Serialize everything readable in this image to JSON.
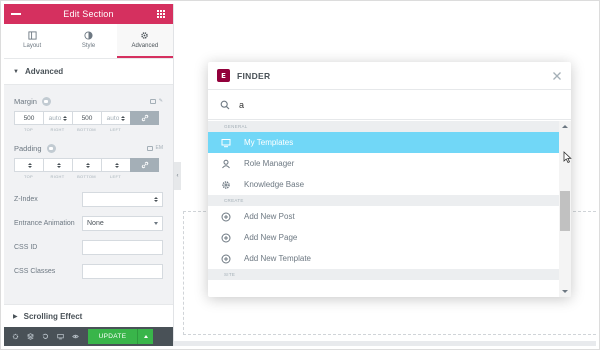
{
  "panel": {
    "title": "Edit Section",
    "tabs": [
      {
        "label": "Layout",
        "icon": "layout-icon"
      },
      {
        "label": "Style",
        "icon": "style-icon"
      },
      {
        "label": "Advanced",
        "icon": "gear-icon",
        "active": true
      }
    ],
    "section_advanced": "Advanced",
    "margin": {
      "label": "Margin",
      "top": "500",
      "right": "auto",
      "bottom": "500",
      "left": "auto",
      "caps": [
        "TOP",
        "RIGHT",
        "BOTTOM",
        "LEFT"
      ]
    },
    "padding": {
      "label": "Padding",
      "unit": "EM",
      "caps": [
        "TOP",
        "RIGHT",
        "BOTTOM",
        "LEFT"
      ]
    },
    "z_index": {
      "label": "Z-Index",
      "value": ""
    },
    "entrance_animation": {
      "label": "Entrance Animation",
      "value": "None"
    },
    "css_id": {
      "label": "CSS ID",
      "value": ""
    },
    "css_classes": {
      "label": "CSS Classes",
      "value": ""
    },
    "section_scrolling": "Scrolling Effect",
    "footer": {
      "update_label": "UPDATE"
    }
  },
  "finder": {
    "title": "FINDER",
    "search_value": "a",
    "categories": {
      "general": "GENERAL",
      "create": "CREATE",
      "site": "SITE"
    },
    "general_items": [
      {
        "label": "My Templates",
        "icon": "monitor-icon",
        "active": true
      },
      {
        "label": "Role Manager",
        "icon": "user-icon"
      },
      {
        "label": "Knowledge Base",
        "icon": "gear-icon"
      }
    ],
    "create_items": [
      {
        "label": "Add New Post",
        "icon": "plus-circle-icon"
      },
      {
        "label": "Add New Page",
        "icon": "plus-circle-icon"
      },
      {
        "label": "Add New Template",
        "icon": "plus-circle-icon"
      }
    ]
  },
  "colors": {
    "header": "#d5305f",
    "finder_highlight": "#71d7f7",
    "update": "#39b54a",
    "footer": "#495157"
  }
}
